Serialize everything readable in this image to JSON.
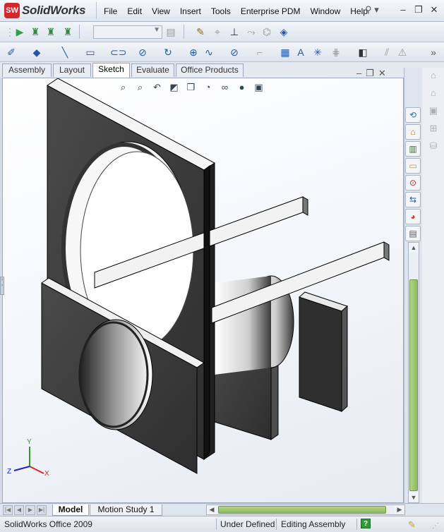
{
  "app": {
    "logo_mark": "SW",
    "logo_text": "SolidWorks"
  },
  "menu": [
    "File",
    "Edit",
    "View",
    "Insert",
    "Tools",
    "Enterprise PDM",
    "Window",
    "Help"
  ],
  "window_controls": {
    "minimize": "–",
    "restore": "❐",
    "close": "✕"
  },
  "tabs": [
    "Assembly",
    "Layout",
    "Sketch",
    "Evaluate",
    "Office Products"
  ],
  "active_tab": "Sketch",
  "bottom_tabs": [
    "Model",
    "Motion Study 1"
  ],
  "status": {
    "app_name": "SolidWorks Office 2009",
    "sketch_state": "Under Defined",
    "mode": "Editing Assembly",
    "help_icon": "?"
  },
  "triad": {
    "x": "X",
    "y": "Y",
    "z": "Z"
  },
  "icons": {
    "toolbar1": [
      "play-icon",
      "rebuild-icon",
      "rebuild2-icon",
      "rebuild3-icon",
      "combo-icon",
      "sketch-icon",
      "smart-dim-icon",
      "relations-icon",
      "mirror-icon",
      "measure-icon",
      "tag-icon"
    ],
    "toolbar2": [
      "sketch-edit-icon",
      "marker-icon",
      "line-icon",
      "rectangle-icon",
      "slot-icon",
      "circle-icon",
      "arc-icon",
      "point-icon",
      "spline-icon",
      "ellipse-icon",
      "fillet-icon",
      "grid-icon",
      "text-icon",
      "asterisk-icon",
      "pattern-icon",
      "offset-icon",
      "convert-icon",
      "warning-icon"
    ],
    "heads_up": [
      "zoom-to-fit-icon",
      "zoom-area-icon",
      "previous-view-icon",
      "section-view-icon",
      "view-orientation-icon",
      "display-style-icon",
      "hide-show-icon",
      "edit-appearance-icon",
      "apply-scene-icon"
    ],
    "task_pane": [
      "solidworks-resources-icon",
      "home-icon",
      "design-library-icon",
      "file-explorer-icon",
      "search-icon",
      "view-palette-icon",
      "appearances-icon",
      "custom-properties-icon"
    ]
  }
}
